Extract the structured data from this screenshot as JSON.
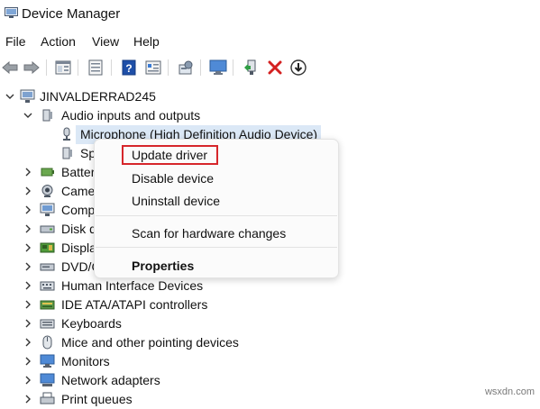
{
  "window": {
    "title": "Device Manager"
  },
  "menu": [
    "File",
    "Action",
    "View",
    "Help"
  ],
  "toolbar": {
    "icons": [
      "back-icon",
      "forward-icon",
      "properties-icon",
      "show-hidden-icon",
      "help-icon",
      "view-icon",
      "scan-icon",
      "monitor-icon",
      "update-driver-icon",
      "uninstall-icon",
      "download-icon"
    ]
  },
  "tree": {
    "root": "JINVALDERRAD245",
    "audio_group": "Audio inputs and outputs",
    "audio_children": [
      "Microphone (High Definition Audio Device)",
      "Sp"
    ],
    "categories": [
      "Batter",
      "Came",
      "Comp",
      "Disk d",
      "Displa",
      "DVD/C",
      "Human Interface Devices",
      "IDE ATA/ATAPI controllers",
      "Keyboards",
      "Mice and other pointing devices",
      "Monitors",
      "Network adapters",
      "Print queues"
    ]
  },
  "context_menu": {
    "items": [
      "Update driver",
      "Disable device",
      "Uninstall device",
      "Scan for hardware changes",
      "Properties"
    ]
  },
  "watermark": "wsxdn.com",
  "colors": {
    "selection": "#dbe8f6",
    "highlight_box": "#d6262b",
    "delete_red": "#d42020",
    "help_blue": "#1e4fa8"
  }
}
